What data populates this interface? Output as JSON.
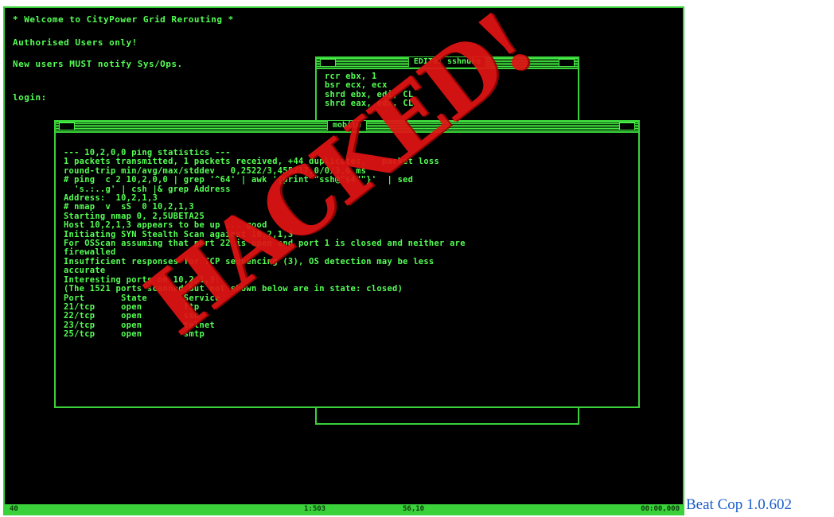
{
  "terminal": {
    "welcome": "* Welcome to CityPower Grid Rerouting *",
    "authorised": "Authorised Users only!",
    "notify": "New users MUST notify Sys/Ops.",
    "login": "login:"
  },
  "editor_window": {
    "title": "EDIT01 sshnuke",
    "lines": [
      "rcr ebx, 1",
      "bsr ecx, ecx",
      "shrd ebx, edi, CL",
      "shrd eax, edx, CL"
    ]
  },
  "mobile_window": {
    "title": "mobile",
    "lines": [
      "--- 10,2,0,0 ping statistics ---",
      "1 packets transmitted, 1 packets received, +44 duplicates,   packet loss",
      "round-trip min/avg/max/stddev   0,2522/3,455/17,0/0/3,0 ms",
      "# ping  c 2 10,2,0,0 | grep '^64' | awk '{print \"ssh@\"$4\"\"}'  | sed",
      "  's.:..g' | csh |& grep Address",
      "Address:  10,2,1,3",
      "",
      "# nmap  v  sS  0 10,2,1,3",
      "",
      "Starting nmap 0, 2,5UBETA25",
      "Host 10,2,1,3 appears to be up ... good",
      "Initiating SYN Stealth Scan against 10,2,1,3",
      "For OSScan assuming that port 22 is open and port 1 is closed and neither are",
      "firewalled",
      "Insufficient responses for TCP sequencing (3), OS detection may be less",
      "accurate",
      "Interesting ports on 10,2,1,3:",
      "(The 1521 ports scanned but not shown below are in state: closed)",
      "Port       State       Service",
      "21/tcp     open        ftp",
      "22/tcp     open        ssh",
      "23/tcp     open        telnet",
      "25/tcp     open        smtp"
    ]
  },
  "status_bar": {
    "left": "40",
    "center_left": "1:503",
    "center": "56,10",
    "right": "00:00,000"
  },
  "stamp_text": "HACKED!",
  "caption": "Beat Cop 1.0.602",
  "colors": {
    "phosphor": "#54ff54",
    "frame": "#3ad13a",
    "stamp": "#e01414",
    "caption": "#1a5cc8"
  }
}
